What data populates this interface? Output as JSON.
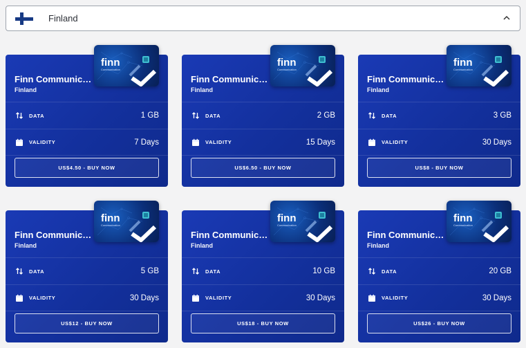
{
  "selector": {
    "country": "Finland",
    "flag_icon": "finland-flag-icon",
    "chevron_icon": "chevron-up-icon"
  },
  "colors": {
    "card": "#13309d",
    "flag_blue": "#173a84"
  },
  "labels": {
    "data": "DATA",
    "validity": "VALIDITY"
  },
  "plans": [
    {
      "name": "Finn Communications",
      "country": "Finland",
      "data": "1 GB",
      "validity": "7 Days",
      "button": "US$4.50 - BUY NOW"
    },
    {
      "name": "Finn Communications",
      "country": "Finland",
      "data": "2 GB",
      "validity": "15 Days",
      "button": "US$6.50 - BUY NOW"
    },
    {
      "name": "Finn Communications",
      "country": "Finland",
      "data": "3 GB",
      "validity": "30 Days",
      "button": "US$8 - BUY NOW"
    },
    {
      "name": "Finn Communications",
      "country": "Finland",
      "data": "5 GB",
      "validity": "30 Days",
      "button": "US$12 - BUY NOW"
    },
    {
      "name": "Finn Communications",
      "country": "Finland",
      "data": "10 GB",
      "validity": "30 Days",
      "button": "US$18 - BUY NOW"
    },
    {
      "name": "Finn Communications",
      "country": "Finland",
      "data": "20 GB",
      "validity": "30 Days",
      "button": "US$26 - BUY NOW"
    }
  ],
  "sim_brand": {
    "logo": "finn",
    "sub": "Communication"
  }
}
